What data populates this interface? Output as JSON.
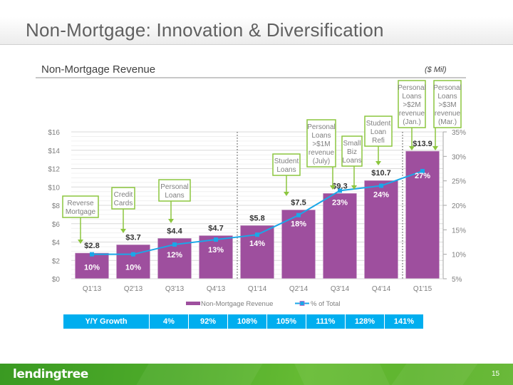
{
  "page": {
    "title": "Non-Mortgage:  Innovation & Diversification",
    "section_title": "Non-Mortgage Revenue",
    "units": "($ Mil)",
    "page_number": "15",
    "logo_text": "lendingtree"
  },
  "colors": {
    "bar": "#9e4f9e",
    "line": "#1aa7e8",
    "annotation_border": "#8cc63f",
    "table_bg": "#00aeef",
    "footer_green": "#4fac2a"
  },
  "chart_data": {
    "type": "bar",
    "title": "Non-Mortgage Revenue",
    "units": "($ Mil)",
    "categories": [
      "Q1'13",
      "Q2'13",
      "Q3'13",
      "Q4'13",
      "Q1'14",
      "Q2'14",
      "Q3'14",
      "Q4'14",
      "Q1'15"
    ],
    "series": [
      {
        "name": "Non-Mortgage Revenue",
        "type": "bar",
        "axis": "left",
        "values": [
          2.8,
          3.7,
          4.4,
          4.7,
          5.8,
          7.5,
          9.3,
          10.7,
          13.9
        ],
        "labels": [
          "$2.8",
          "$3.7",
          "$4.4",
          "$4.7",
          "$5.8",
          "$7.5",
          "$9.3",
          "$10.7",
          "$13.9"
        ]
      },
      {
        "name": "% of Total",
        "type": "line",
        "axis": "right",
        "values": [
          10,
          10,
          12,
          13,
          14,
          18,
          23,
          24,
          27
        ],
        "labels": [
          "10%",
          "10%",
          "12%",
          "13%",
          "14%",
          "18%",
          "23%",
          "24%",
          "27%"
        ]
      }
    ],
    "left_axis": {
      "ylim": [
        0,
        16
      ],
      "ticks": [
        0,
        2,
        4,
        6,
        8,
        10,
        12,
        14,
        16
      ],
      "tick_labels": [
        "$0",
        "$2",
        "$4",
        "$6",
        "$8",
        "$10",
        "$12",
        "$14",
        "$16"
      ]
    },
    "right_axis": {
      "ylim": [
        5,
        35
      ],
      "ticks": [
        5,
        10,
        15,
        20,
        25,
        30,
        35
      ],
      "tick_labels": [
        "5%",
        "10%",
        "15%",
        "20%",
        "25%",
        "30%",
        "35%"
      ]
    },
    "dividers_after_index": [
      3,
      7
    ],
    "grid": true,
    "legend": {
      "position": "bottom",
      "entries": [
        "Non-Mortgage Revenue",
        "% of Total"
      ]
    },
    "annotations": [
      {
        "index": 0,
        "lines": [
          "Reverse",
          "Mortgage"
        ]
      },
      {
        "index": 1,
        "lines": [
          "Credit",
          "Cards"
        ]
      },
      {
        "index": 2,
        "lines": [
          "Personal",
          "Loans"
        ]
      },
      {
        "index": 5,
        "lines": [
          "Student",
          "Loans"
        ]
      },
      {
        "index": 6,
        "lines": [
          "Personal",
          "Loans",
          ">$1M",
          "revenue",
          "(July)"
        ]
      },
      {
        "index": 6,
        "lines": [
          "Small",
          "Biz",
          "Loans"
        ]
      },
      {
        "index": 7,
        "lines": [
          "Student",
          "Loan",
          "Refi"
        ]
      },
      {
        "index": 8,
        "lines": [
          "Personal",
          "Loans",
          ">$2M",
          "revenue",
          "(Jan.)"
        ]
      },
      {
        "index": 8,
        "lines": [
          "Personal",
          "Loans",
          ">$3M",
          "revenue",
          "(Mar.)"
        ]
      }
    ]
  },
  "growth_table": {
    "label": "Y/Y Growth",
    "values": [
      "4%",
      "92%",
      "108%",
      "105%",
      "111%",
      "128%",
      "141%"
    ]
  }
}
